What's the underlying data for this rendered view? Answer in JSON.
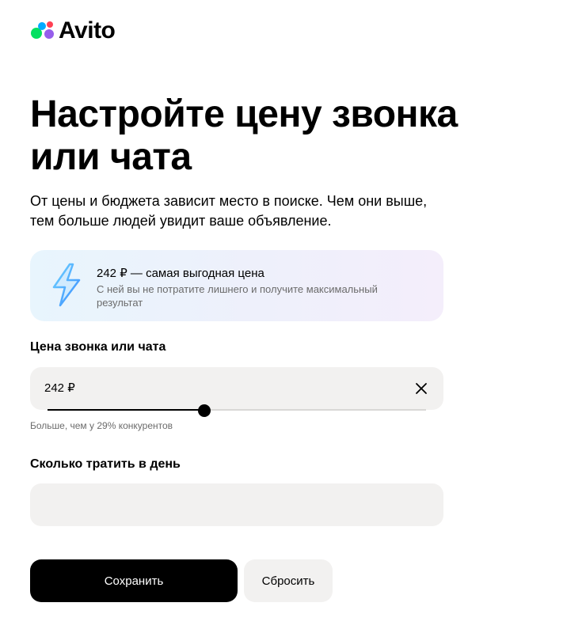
{
  "header": {
    "logo_text": "Avito"
  },
  "page": {
    "title": "Настройте цену звонка или чата",
    "subtitle": "От цены и бюджета зависит место в поиске. Чем они выше, тем больше людей увидит ваше объявление."
  },
  "promo": {
    "icon": "lightning-icon",
    "title": "242 ₽ — самая выгодная цена",
    "text": "С ней вы не потратите лишнего и получите максимальный результат"
  },
  "price": {
    "label": "Цена звонка или чата",
    "value": "242 ₽",
    "slider_fraction": 0.415,
    "hint": "Больше, чем у 29% конкурентов"
  },
  "daily": {
    "label": "Сколько тратить в день",
    "value": ""
  },
  "actions": {
    "save_label": "Сохранить",
    "reset_label": "Сбросить"
  },
  "colors": {
    "primary_button": "#000000",
    "field_background": "#f2f1f0",
    "hint_text": "#6b6b6b"
  }
}
